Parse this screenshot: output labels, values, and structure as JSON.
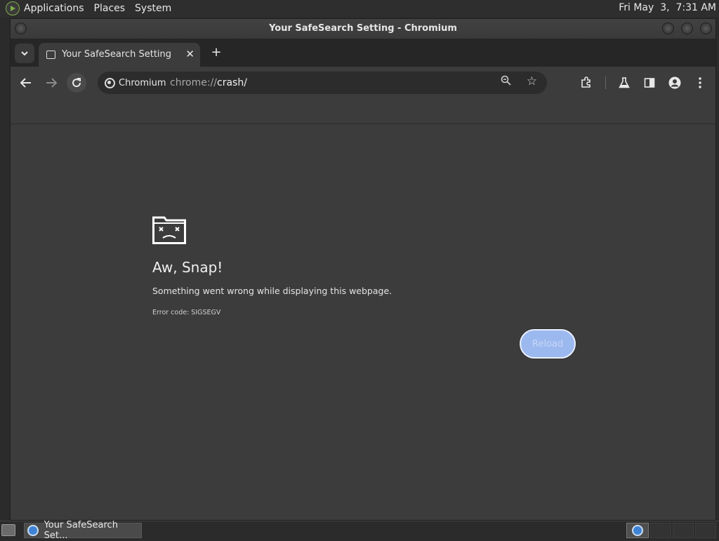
{
  "top_panel": {
    "menus": [
      "Applications",
      "Places",
      "System"
    ],
    "clock": "Fri May  3,  7:31 AM"
  },
  "window": {
    "title": "Your SafeSearch Setting - Chromium"
  },
  "tab": {
    "title": "Your SafeSearch Setting",
    "close_glyph": "✕",
    "new_tab_glyph": "+"
  },
  "toolbar": {
    "site_chip": "Chromium",
    "url_prefix": "chrome://",
    "url_host": "crash/"
  },
  "content": {
    "heading": "Aw, Snap!",
    "message": "Something went wrong while displaying this webpage.",
    "error_code": "Error code: SIGSEGV",
    "reload_label": "Reload"
  },
  "taskbar": {
    "task_label": "Your SafeSearch Set..."
  },
  "icons": {
    "tab_search": "chevron-down-icon",
    "back": "back-arrow-icon",
    "forward": "forward-arrow-icon",
    "reload": "reload-icon",
    "zoom": "zoom-icon",
    "bookmark": "star-icon",
    "extensions": "puzzle-icon",
    "labs": "flask-icon",
    "side_panel": "side-panel-icon",
    "profile": "profile-icon",
    "menu": "kebab-menu-icon"
  },
  "colors": {
    "reload_button": "#9cb9ef",
    "content_bg": "#3c3c3c",
    "tab_strip_bg": "#262626"
  }
}
